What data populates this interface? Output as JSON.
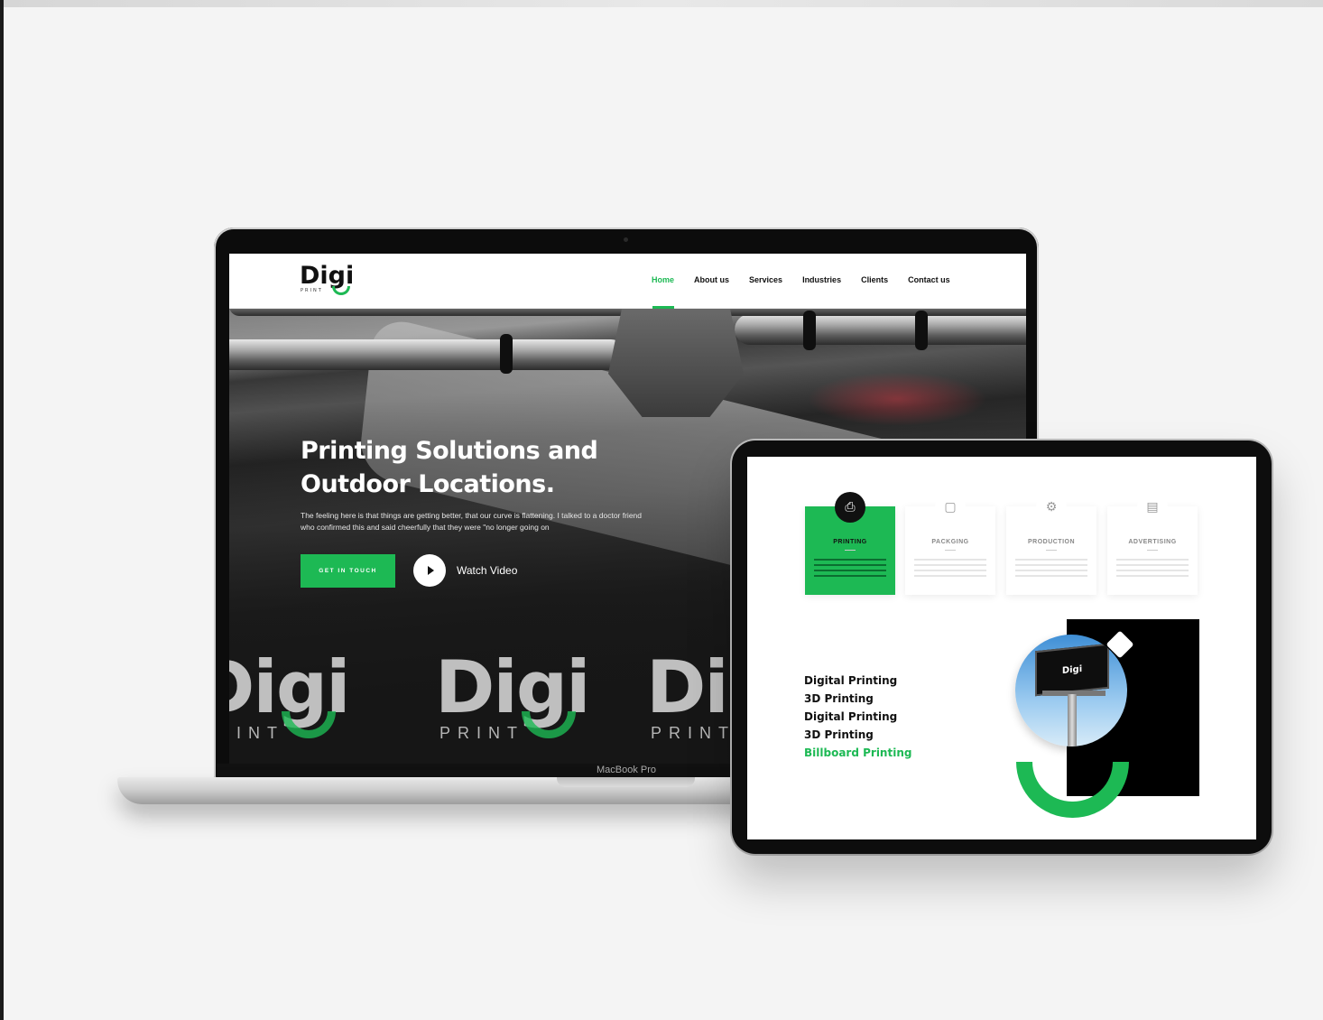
{
  "laptop": {
    "model_label": "MacBook Pro",
    "site": {
      "logo": {
        "text": "Digi",
        "sub": "PRINT"
      },
      "nav": [
        {
          "label": "Home",
          "active": true
        },
        {
          "label": "About us",
          "active": false
        },
        {
          "label": "Services",
          "active": false
        },
        {
          "label": "Industries",
          "active": false
        },
        {
          "label": "Clients",
          "active": false
        },
        {
          "label": "Contact us",
          "active": false
        }
      ],
      "hero": {
        "title_line1": "Printing Solutions and",
        "title_line2": "Outdoor Locations.",
        "text": "The feeling here is that things are getting better, that our curve is flattening. I talked to a doctor friend who confirmed this and said cheerfully that they were \"no longer going on",
        "cta_label": "GET IN TOUCH",
        "watch_label": "Watch Video",
        "brand_word": "Digi",
        "brand_sub": "PRINT"
      }
    }
  },
  "tablet": {
    "cards": [
      {
        "title": "PRINTING",
        "icon": "printer-icon",
        "active": true
      },
      {
        "title": "PACKGING",
        "icon": "box-icon",
        "active": false
      },
      {
        "title": "PRODUCTION",
        "icon": "production-icon",
        "active": false
      },
      {
        "title": "ADVERTISING",
        "icon": "billboard-icon",
        "active": false
      }
    ],
    "list": [
      "Digital Printing",
      "3D Printing",
      "Digital Printing",
      "3D Printing",
      "Billboard Printing"
    ],
    "billboard_text": "Digi"
  },
  "colors": {
    "accent": "#1db954",
    "dark": "#0d0d0d",
    "background": "#f4f4f4"
  }
}
